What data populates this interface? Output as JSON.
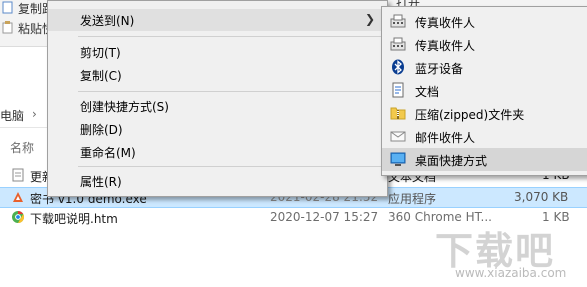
{
  "ribbon": {
    "copy_path_label": "复制路",
    "paste_shortcut_label": "粘贴快",
    "open_label": "打开"
  },
  "address_bar": {
    "location_label": "电脑"
  },
  "columns": {
    "name_header": "名称"
  },
  "files": [
    {
      "name": "更新",
      "date": "",
      "type": "文本文档",
      "size": "1 KB",
      "icon": "text-file-icon",
      "selected": false
    },
    {
      "name": "密书 v1.0 demo.exe",
      "date": "2021-02-28 21:52",
      "type": "应用程序",
      "size": "3,070 KB",
      "icon": "app-icon",
      "selected": true
    },
    {
      "name": "下载吧说明.htm",
      "date": "2020-12-07 15:27",
      "type": "360 Chrome HT...",
      "size": "1 KB",
      "icon": "chrome-html-icon",
      "selected": false
    }
  ],
  "context_menu": {
    "send_to": "发送到(N)",
    "cut": "剪切(T)",
    "copy": "复制(C)",
    "create_shortcut": "创建快捷方式(S)",
    "delete": "删除(D)",
    "rename": "重命名(M)",
    "properties": "属性(R)"
  },
  "send_to_menu": [
    {
      "label": "传真收件人",
      "icon": "fax-icon"
    },
    {
      "label": "传真收件人",
      "icon": "fax-icon"
    },
    {
      "label": "蓝牙设备",
      "icon": "bluetooth-icon"
    },
    {
      "label": "文档",
      "icon": "documents-folder-icon"
    },
    {
      "label": "压缩(zipped)文件夹",
      "icon": "zip-folder-icon"
    },
    {
      "label": "邮件收件人",
      "icon": "mail-recipient-icon"
    },
    {
      "label": "桌面快捷方式",
      "icon": "desktop-shortcut-icon"
    }
  ],
  "watermark": {
    "brand": "下载吧",
    "url": "www.xiazaiba.com"
  },
  "colors": {
    "selection": "#cce8ff",
    "menu_bg": "#f0f0f0",
    "menu_hover": "#d6d6d6"
  }
}
